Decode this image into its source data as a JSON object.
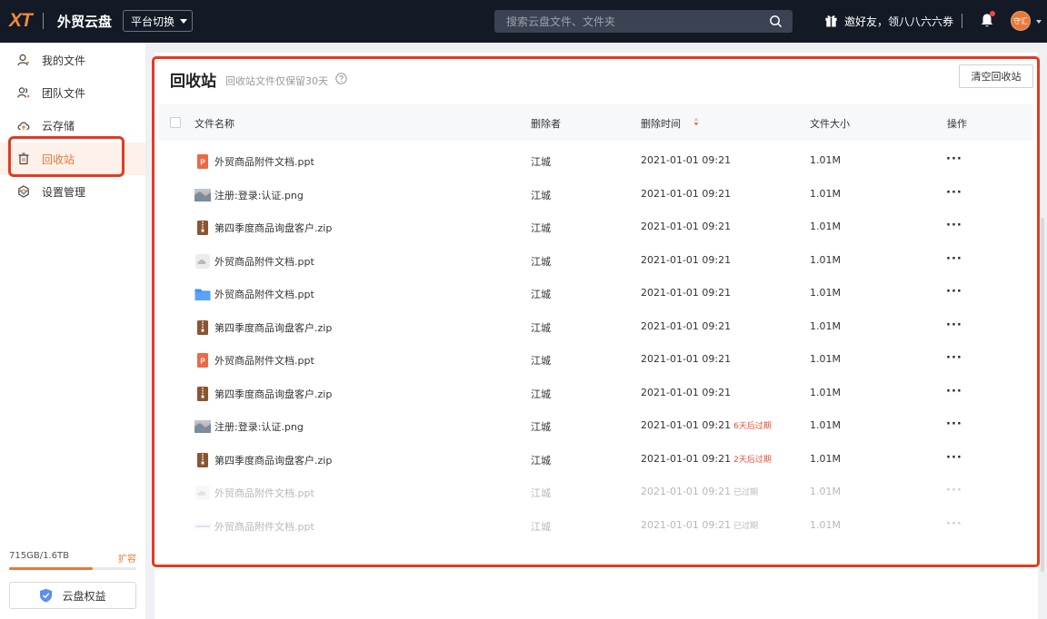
{
  "topbar": {
    "logo": "XT",
    "app_title": "外贸云盘",
    "platform_switch": "平台切换",
    "search_placeholder": "搜索云盘文件、文件夹",
    "invite_text": "邀好友，领八八六六券",
    "avatar_text": "守汇",
    "colors": {
      "bar": "#131a26",
      "accent": "#e8783a"
    }
  },
  "sidebar": {
    "items": [
      {
        "label": "我的文件",
        "icon": "user-icon",
        "active": false
      },
      {
        "label": "团队文件",
        "icon": "team-icon",
        "active": false
      },
      {
        "label": "云存储",
        "icon": "cloud-icon",
        "active": false
      },
      {
        "label": "回收站",
        "icon": "trash-icon",
        "active": true
      },
      {
        "label": "设置管理",
        "icon": "settings-icon",
        "active": false
      }
    ],
    "storage_text": "715GB/1.6TB",
    "storage_ratio": 0.66,
    "expand_label": "扩容",
    "benefit_label": "云盘权益"
  },
  "main": {
    "title": "回收站",
    "note": "回收站文件仅保留30天",
    "clear_button": "清空回收站",
    "columns": {
      "name": "文件名称",
      "deleter": "删除者",
      "time": "删除时间",
      "size": "文件大小",
      "actions": "操作"
    },
    "rows": [
      {
        "name": "外贸商品附件文档.ppt",
        "type": "ppt",
        "deleter": "江城",
        "time": "2021-01-01 09:21",
        "warn": "",
        "size": "1.01M",
        "expired": false
      },
      {
        "name": "注册:登录:认证.png",
        "type": "image",
        "deleter": "江城",
        "time": "2021-01-01 09:21",
        "warn": "",
        "size": "1.01M",
        "expired": false
      },
      {
        "name": "第四季度商品询盘客户.zip",
        "type": "zip",
        "deleter": "江城",
        "time": "2021-01-01 09:21",
        "warn": "",
        "size": "1.01M",
        "expired": false
      },
      {
        "name": "外贸商品附件文档.ppt",
        "type": "cloud",
        "deleter": "江城",
        "time": "2021-01-01 09:21",
        "warn": "",
        "size": "1.01M",
        "expired": false
      },
      {
        "name": "外贸商品附件文档.ppt",
        "type": "folder",
        "deleter": "江城",
        "time": "2021-01-01 09:21",
        "warn": "",
        "size": "1.01M",
        "expired": false
      },
      {
        "name": "第四季度商品询盘客户.zip",
        "type": "zip",
        "deleter": "江城",
        "time": "2021-01-01 09:21",
        "warn": "",
        "size": "1.01M",
        "expired": false
      },
      {
        "name": "外贸商品附件文档.ppt",
        "type": "ppt",
        "deleter": "江城",
        "time": "2021-01-01 09:21",
        "warn": "",
        "size": "1.01M",
        "expired": false
      },
      {
        "name": "第四季度商品询盘客户.zip",
        "type": "zip",
        "deleter": "江城",
        "time": "2021-01-01 09:21",
        "warn": "",
        "size": "1.01M",
        "expired": false
      },
      {
        "name": "注册:登录:认证.png",
        "type": "image",
        "deleter": "江城",
        "time": "2021-01-01 09:21",
        "warn": "6天后过期",
        "size": "1.01M",
        "expired": false
      },
      {
        "name": "第四季度商品询盘客户.zip",
        "type": "zip",
        "deleter": "江城",
        "time": "2021-01-01 09:21",
        "warn": "2天后过期",
        "size": "1.01M",
        "expired": false
      },
      {
        "name": "外贸商品附件文档.ppt",
        "type": "cloud",
        "deleter": "江城",
        "time": "2021-01-01 09:21",
        "warn": "已过期",
        "size": "1.01M",
        "expired": true
      },
      {
        "name": "外贸商品附件文档.ppt",
        "type": "doc",
        "deleter": "江城",
        "time": "2021-01-01 09:21",
        "warn": "已过期",
        "size": "1.01M",
        "expired": true
      }
    ],
    "more_label": "···"
  }
}
